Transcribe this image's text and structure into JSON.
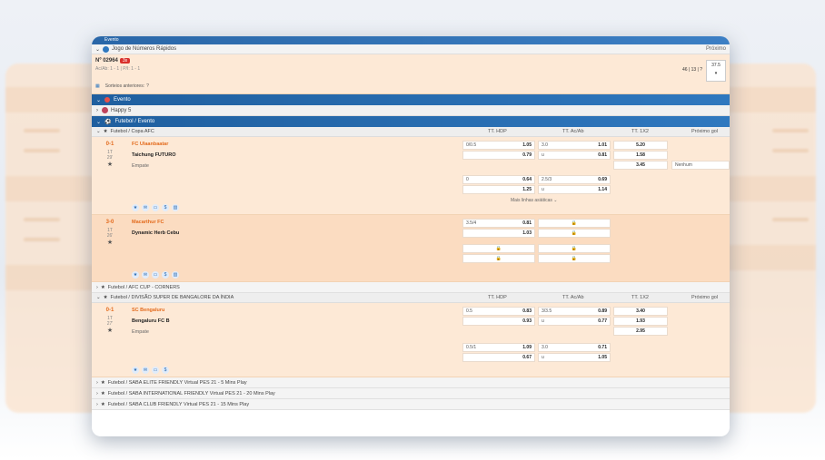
{
  "window": {
    "top_label": "Evento",
    "title": "Jogo de Números Rápidos",
    "next_label": "Próximo"
  },
  "rapid": {
    "number": "Nº 02964",
    "badge": "3s",
    "sub": "Ac/Ab: 1 - 1 | P/I: 1 - 1",
    "previous": "Sorteios anteriores:",
    "nums": "46 | 13 | ?",
    "box_top": "37.5",
    "box_bottom": "▾"
  },
  "sections": {
    "evento": "Evento",
    "happy": "Happy 5",
    "futebol_evento": "Futebol / Evento"
  },
  "columns": {
    "hdp": "TT. HDP",
    "acab": "TT. Ac/Ab",
    "x12": "TT. 1X2",
    "next_goal": "Próximo gol"
  },
  "leagues": {
    "copa_afc": "Futebol / Copa AFC",
    "afc_corners": "Futebol / AFC CUP - CORNERS",
    "india": "Futebol / DIVISÃO SUPER DE BANGALORE DA ÍNDIA",
    "saba_elite": "Futebol / SABA ELITE FRIENDLY Virtual PES 21 - 5 Mins Play",
    "saba_intl": "Futebol / SABA INTERNATIONAL FRIENDLY Virtual PES 21 - 20 Mins Play",
    "saba_club": "Futebol / SABA CLUB FRIENDLY Virtual PES 21 - 15 Mins Play"
  },
  "matches": [
    {
      "score": "0-1",
      "period": "1T",
      "minute": "29'",
      "home": "FC Ulaanbaatar",
      "away": "Taichung FUTURO",
      "draw": "Empate",
      "hdp1": {
        "line": "0/0.5",
        "home": "1.05",
        "away": "0.79"
      },
      "ou1": {
        "line": "3.0",
        "over": "1.01",
        "u": "u",
        "under": "0.81"
      },
      "x12": {
        "h": "5.20",
        "a": "1.58",
        "d": "3.45"
      },
      "next_goal": "Nenhum",
      "hdp2": {
        "line": "0",
        "home": "0.64",
        "away": "1.25"
      },
      "ou2": {
        "line": "2.5/3",
        "over": "0.69",
        "u": "u",
        "under": "1.14"
      },
      "more": "Mais linhas asiáticas"
    },
    {
      "score": "3-0",
      "period": "1T",
      "minute": "26'",
      "home": "Macarthur FC",
      "away": "Dynamic Herb Cebu",
      "hdp1": {
        "line": "3.5/4",
        "home": "0.81",
        "away": "1.03"
      }
    },
    {
      "score": "0-1",
      "period": "1T",
      "minute": "27'",
      "home": "SC Bengaluru",
      "away": "Bengaluru FC B",
      "draw": "Empate",
      "hdp1": {
        "line": "0.5",
        "home": "0.83",
        "away": "0.93"
      },
      "ou1": {
        "line": "3/3.5",
        "over": "0.89",
        "u": "u",
        "under": "0.77"
      },
      "x12": {
        "h": "3.40",
        "a": "1.93",
        "d": "2.95"
      },
      "hdp2": {
        "line": "0.5/1",
        "home": "1.09",
        "away": "0.67"
      },
      "ou2": {
        "line": "3.0",
        "over": "0.71",
        "u": "u",
        "under": "1.05"
      }
    }
  ],
  "colors": {
    "accent": "#2f78bf",
    "orange": "#e36b1d",
    "panel": "#fde9d6"
  }
}
